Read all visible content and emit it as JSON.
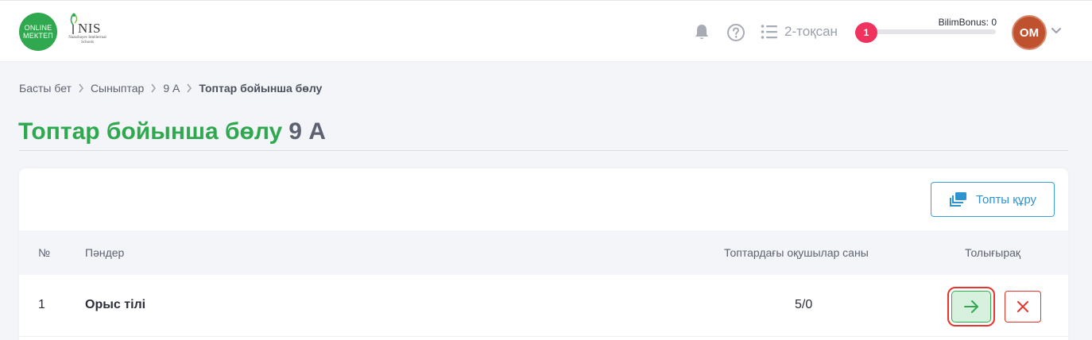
{
  "header": {
    "logo_online_line1": "ONLINE",
    "logo_online_line2": "МЕКТЕП",
    "logo_nis_text": "NIS",
    "logo_nis_sub": "Nazarbayev Intellectual Schools",
    "quarter_label": "2-тоқсан",
    "bonus_label": "BilimBonus: 0",
    "bonus_level": "1",
    "avatar_initials": "OM",
    "icons": [
      "bell-icon",
      "help-icon",
      "list-icon",
      "chevron-down-icon"
    ]
  },
  "breadcrumb": {
    "items": [
      "Басты бет",
      "Сыныптар",
      "9 А"
    ],
    "current": "Топтар бойынша бөлу"
  },
  "page": {
    "title": "Топтар бойынша бөлу",
    "class_name": "9 А"
  },
  "toolbar": {
    "create_group_label": "Топты құру"
  },
  "table": {
    "headers": {
      "num": "№",
      "subjects": "Пәндер",
      "students_count": "Топтардағы оқушылар саны",
      "details": "Толығырақ"
    },
    "rows": [
      {
        "num": "1",
        "subject": "Орыс тілі",
        "count": "5/0"
      }
    ]
  },
  "colors": {
    "brand_green": "#2fa84f",
    "accent_blue": "#2f93d0",
    "danger_red": "#e5352c",
    "badge_pink": "#f0325f"
  }
}
